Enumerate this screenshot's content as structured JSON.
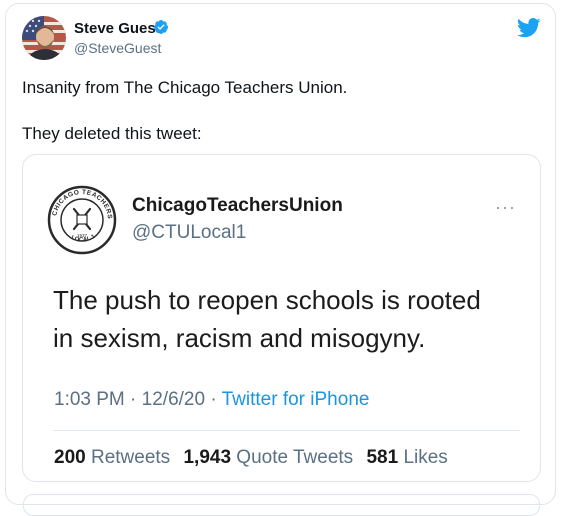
{
  "author": {
    "name": "Steve Guest",
    "handle": "@SteveGuest",
    "verified": true
  },
  "tweet": {
    "line1": "Insanity from The Chicago Teachers Union.",
    "line2": "They deleted this tweet:"
  },
  "quoted": {
    "name": "ChicagoTeachersUnion",
    "handle": "@CTULocal1",
    "logo_text_top": "CHICAGO TEACHERS UNION",
    "logo_text_bottom": "LOCAL 1",
    "logo_year": "1937",
    "more": "···",
    "text_line1": "The push to reopen schools is rooted",
    "text_line2": "in sexism, racism and misogyny.",
    "time": "1:03 PM",
    "sep1": " · ",
    "date": "12/6/20",
    "sep2": " · ",
    "source": "Twitter for iPhone",
    "stats": {
      "retweets_count": "200",
      "retweets_label": "Retweets",
      "quotes_count": "1,943",
      "quotes_label": "Quote Tweets",
      "likes_count": "581",
      "likes_label": "Likes"
    }
  },
  "colors": {
    "twitter_blue": "#1da1f2",
    "link_blue": "#1b95e0",
    "muted": "#5b7083",
    "border": "#dfe5ea"
  },
  "icons": {
    "brand": "twitter-bird-icon",
    "verified": "verified-badge-icon",
    "more": "more-options-icon"
  }
}
